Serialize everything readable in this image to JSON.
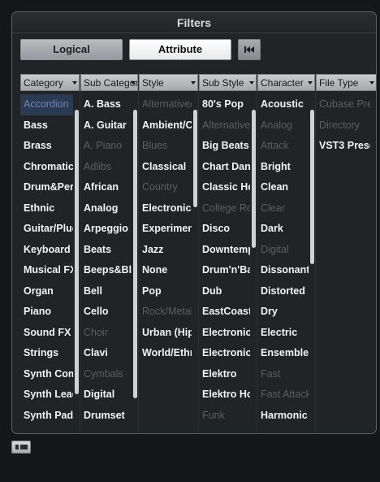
{
  "panel": {
    "title": "Filters"
  },
  "toolbar": {
    "tabs": [
      {
        "label": "Logical",
        "active": false
      },
      {
        "label": "Attribute",
        "active": true
      }
    ],
    "reset_icon": "skip-to-start-icon"
  },
  "columns": [
    {
      "header": "Category",
      "items": [
        {
          "label": "Accordion",
          "state": "selected"
        },
        {
          "label": "Bass",
          "state": "normal"
        },
        {
          "label": "Brass",
          "state": "normal"
        },
        {
          "label": "Chromatic",
          "state": "normal"
        },
        {
          "label": "Drum&Perc",
          "state": "normal"
        },
        {
          "label": "Ethnic",
          "state": "normal"
        },
        {
          "label": "Guitar/Plucked",
          "state": "normal"
        },
        {
          "label": "Keyboard",
          "state": "normal"
        },
        {
          "label": "Musical FX",
          "state": "normal"
        },
        {
          "label": "Organ",
          "state": "normal"
        },
        {
          "label": "Piano",
          "state": "normal"
        },
        {
          "label": "Sound FX",
          "state": "normal"
        },
        {
          "label": "Strings",
          "state": "normal"
        },
        {
          "label": "Synth Comp",
          "state": "normal"
        },
        {
          "label": "Synth Lead",
          "state": "normal"
        },
        {
          "label": "Synth Pad",
          "state": "normal"
        }
      ]
    },
    {
      "header": "Sub Category",
      "items": [
        {
          "label": "A. Bass",
          "state": "normal"
        },
        {
          "label": "A. Guitar",
          "state": "normal"
        },
        {
          "label": "A. Piano",
          "state": "dim"
        },
        {
          "label": "Adlibs",
          "state": "dim"
        },
        {
          "label": "African",
          "state": "normal"
        },
        {
          "label": "Analog",
          "state": "normal"
        },
        {
          "label": "Arpeggio",
          "state": "normal"
        },
        {
          "label": "Beats",
          "state": "normal"
        },
        {
          "label": "Beeps&Blips",
          "state": "normal"
        },
        {
          "label": "Bell",
          "state": "normal"
        },
        {
          "label": "Cello",
          "state": "normal"
        },
        {
          "label": "Choir",
          "state": "dim"
        },
        {
          "label": "Clavi",
          "state": "normal"
        },
        {
          "label": "Cymbals",
          "state": "dim"
        },
        {
          "label": "Digital",
          "state": "normal"
        },
        {
          "label": "Drumset",
          "state": "normal"
        }
      ]
    },
    {
      "header": "Style",
      "items": [
        {
          "label": "Alternative/Indie",
          "state": "dim"
        },
        {
          "label": "Ambient/ChillOut",
          "state": "normal"
        },
        {
          "label": "Blues",
          "state": "dim"
        },
        {
          "label": "Classical",
          "state": "normal"
        },
        {
          "label": "Country",
          "state": "dim"
        },
        {
          "label": "Electronica/Dance",
          "state": "normal"
        },
        {
          "label": "Experimental",
          "state": "normal"
        },
        {
          "label": "Jazz",
          "state": "normal"
        },
        {
          "label": "None",
          "state": "normal"
        },
        {
          "label": "Pop",
          "state": "normal"
        },
        {
          "label": "Rock/Metal",
          "state": "dim"
        },
        {
          "label": "Urban (Hip-Hop)",
          "state": "normal"
        },
        {
          "label": "World/Ethnic",
          "state": "normal"
        }
      ]
    },
    {
      "header": "Sub Style",
      "items": [
        {
          "label": "80's Pop",
          "state": "normal"
        },
        {
          "label": "Alternative",
          "state": "dim"
        },
        {
          "label": "Big Beats",
          "state": "normal"
        },
        {
          "label": "Chart Dance",
          "state": "normal"
        },
        {
          "label": "Classic House",
          "state": "normal"
        },
        {
          "label": "College Rock",
          "state": "dim"
        },
        {
          "label": "Disco",
          "state": "normal"
        },
        {
          "label": "Downtempo",
          "state": "normal"
        },
        {
          "label": "Drum'n'Bass",
          "state": "normal"
        },
        {
          "label": "Dub",
          "state": "normal"
        },
        {
          "label": "EastCoast",
          "state": "normal"
        },
        {
          "label": "Electronica",
          "state": "normal"
        },
        {
          "label": "Electronic Body",
          "state": "normal"
        },
        {
          "label": "Elektro",
          "state": "normal"
        },
        {
          "label": "Elektro House",
          "state": "normal"
        },
        {
          "label": "Funk",
          "state": "dim"
        }
      ]
    },
    {
      "header": "Character",
      "items": [
        {
          "label": "Acoustic",
          "state": "normal"
        },
        {
          "label": "Analog",
          "state": "dim"
        },
        {
          "label": "Attack",
          "state": "dim"
        },
        {
          "label": "Bright",
          "state": "normal"
        },
        {
          "label": "Clean",
          "state": "normal"
        },
        {
          "label": "Clear",
          "state": "dim"
        },
        {
          "label": "Dark",
          "state": "normal"
        },
        {
          "label": "Digital",
          "state": "dim"
        },
        {
          "label": "Dissonant",
          "state": "normal"
        },
        {
          "label": "Distorted",
          "state": "normal"
        },
        {
          "label": "Dry",
          "state": "normal"
        },
        {
          "label": "Electric",
          "state": "normal"
        },
        {
          "label": "Ensemble",
          "state": "normal"
        },
        {
          "label": "Fast",
          "state": "dim"
        },
        {
          "label": "Fast Attack",
          "state": "dim"
        },
        {
          "label": "Harmonic",
          "state": "normal"
        }
      ]
    },
    {
      "header": "File Type",
      "items": [
        {
          "label": "Cubase Preset",
          "state": "dim"
        },
        {
          "label": "Directory",
          "state": "dim"
        },
        {
          "label": "VST3 Preset",
          "state": "normal"
        }
      ]
    }
  ]
}
